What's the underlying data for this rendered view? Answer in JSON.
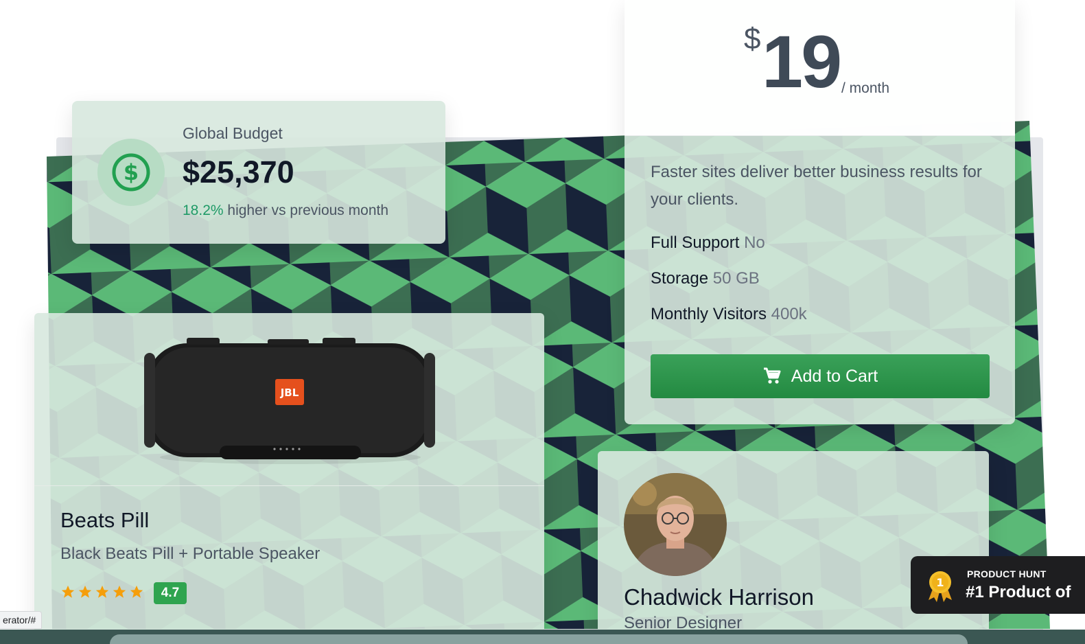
{
  "budget": {
    "label": "Global Budget",
    "amount": "$25,370",
    "change_pct": "18.2%",
    "change_text": "higher vs previous month",
    "icon": "dollar-circle-icon"
  },
  "pricing": {
    "currency": "$",
    "price": "19",
    "period": "/ month",
    "description": "Faster sites deliver better business results for your clients.",
    "features": [
      {
        "label": "Full Support",
        "value": "No"
      },
      {
        "label": "Storage",
        "value": "50 GB"
      },
      {
        "label": "Monthly Visitors",
        "value": "400k"
      }
    ],
    "button_label": "Add to Cart",
    "button_icon": "cart-icon"
  },
  "product": {
    "title": "Beats Pill",
    "subtitle": "Black Beats Pill + Portable Speaker",
    "rating": "4.7",
    "stars": 5,
    "logo_text": "JBL"
  },
  "profile": {
    "name": "Chadwick Harrison",
    "role": "Senior Designer"
  },
  "product_hunt": {
    "kicker": "PRODUCT HUNT",
    "title": "#1 Product of",
    "medal_number": "1"
  },
  "status_bar": {
    "url": "erator/#"
  },
  "colors": {
    "accent_green": "#238a41",
    "pattern_light": "#5bb977",
    "pattern_mid": "#3c6e52",
    "pattern_dark": "#182339",
    "positive_text": "#1f9a67"
  }
}
